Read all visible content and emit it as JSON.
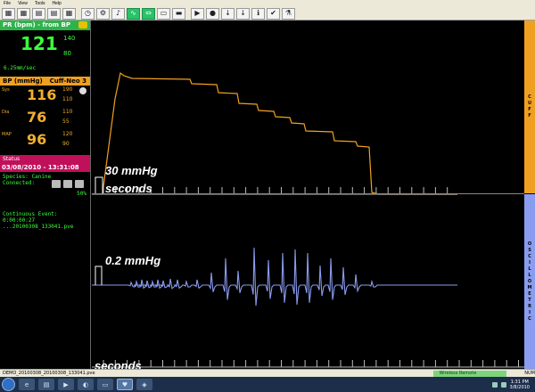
{
  "menu": [
    "File",
    "View",
    "Tools",
    "Help"
  ],
  "toolbar_icons": [
    {
      "name": "grid-icon",
      "glyph": "▦"
    },
    {
      "name": "grid-icon",
      "glyph": "▦"
    },
    {
      "name": "book-icon",
      "glyph": "▤"
    },
    {
      "name": "book-icon",
      "glyph": "▤"
    },
    {
      "name": "grid-icon",
      "glyph": "▦"
    },
    {
      "name": "clock-icon",
      "glyph": "◷"
    },
    {
      "name": "gear-icon",
      "glyph": "⚙"
    },
    {
      "name": "bell-icon",
      "glyph": "♪"
    },
    {
      "name": "wave-icon",
      "glyph": "∿"
    },
    {
      "name": "fit-icon",
      "glyph": "⇔"
    },
    {
      "name": "document-icon",
      "glyph": "▭"
    },
    {
      "name": "print-icon",
      "glyph": "▬"
    },
    {
      "name": "play-pause-icon",
      "glyph": "▶"
    },
    {
      "name": "record-icon",
      "glyph": "●"
    },
    {
      "name": "arrow-down-icon",
      "glyph": "↓"
    },
    {
      "name": "arrow-down-icon",
      "glyph": "↓"
    },
    {
      "name": "info-icon",
      "glyph": "ℹ"
    },
    {
      "name": "check-icon",
      "glyph": "✔"
    },
    {
      "name": "flask-icon",
      "glyph": "⚗"
    }
  ],
  "pr": {
    "header": "PR (bpm) - from BP",
    "value": "121",
    "high": "140",
    "low": "80",
    "speed": "6.25mm/sec"
  },
  "bp": {
    "header": "BP (mmHg)",
    "cuff": "Cuff-Neo 3",
    "rows": [
      {
        "label": "Sys",
        "value": "116",
        "high": "190",
        "low": "110"
      },
      {
        "label": "Dia",
        "value": "76",
        "high": "110",
        "low": "55"
      },
      {
        "label": "MAP",
        "value": "96",
        "high": "120",
        "low": "90"
      }
    ]
  },
  "status": {
    "header": "Status",
    "datetime": "03/08/2010 - 13:31:08",
    "species": "Species: Canine",
    "connected": "Connected:",
    "signal": "50%"
  },
  "event": {
    "title": "Continuous Event:",
    "time": "0:00:00:27",
    "file": "...20100308_133041.pve"
  },
  "cuff_panel": {
    "strip_label": "CUFF",
    "scale": "30 mmHg",
    "time_label": "seconds"
  },
  "osc_panel": {
    "strip_label": "OSCILLOMETRIC",
    "scale": "0.2 mmHg",
    "time_label": "seconds"
  },
  "statusbar": {
    "file": "DEMO_20100308_20100308_133041.pve",
    "wireless": "Wireless Remote Connected",
    "num": "NUM"
  },
  "taskbar": {
    "time": "1:31 PM",
    "date": "3/8/2010"
  },
  "colors": {
    "pr": "#3cff3c",
    "bp": "#f3b030",
    "cuff_trace": "#f0a020",
    "osc_trace": "#8a9cf0",
    "status": "#c0105a"
  }
}
